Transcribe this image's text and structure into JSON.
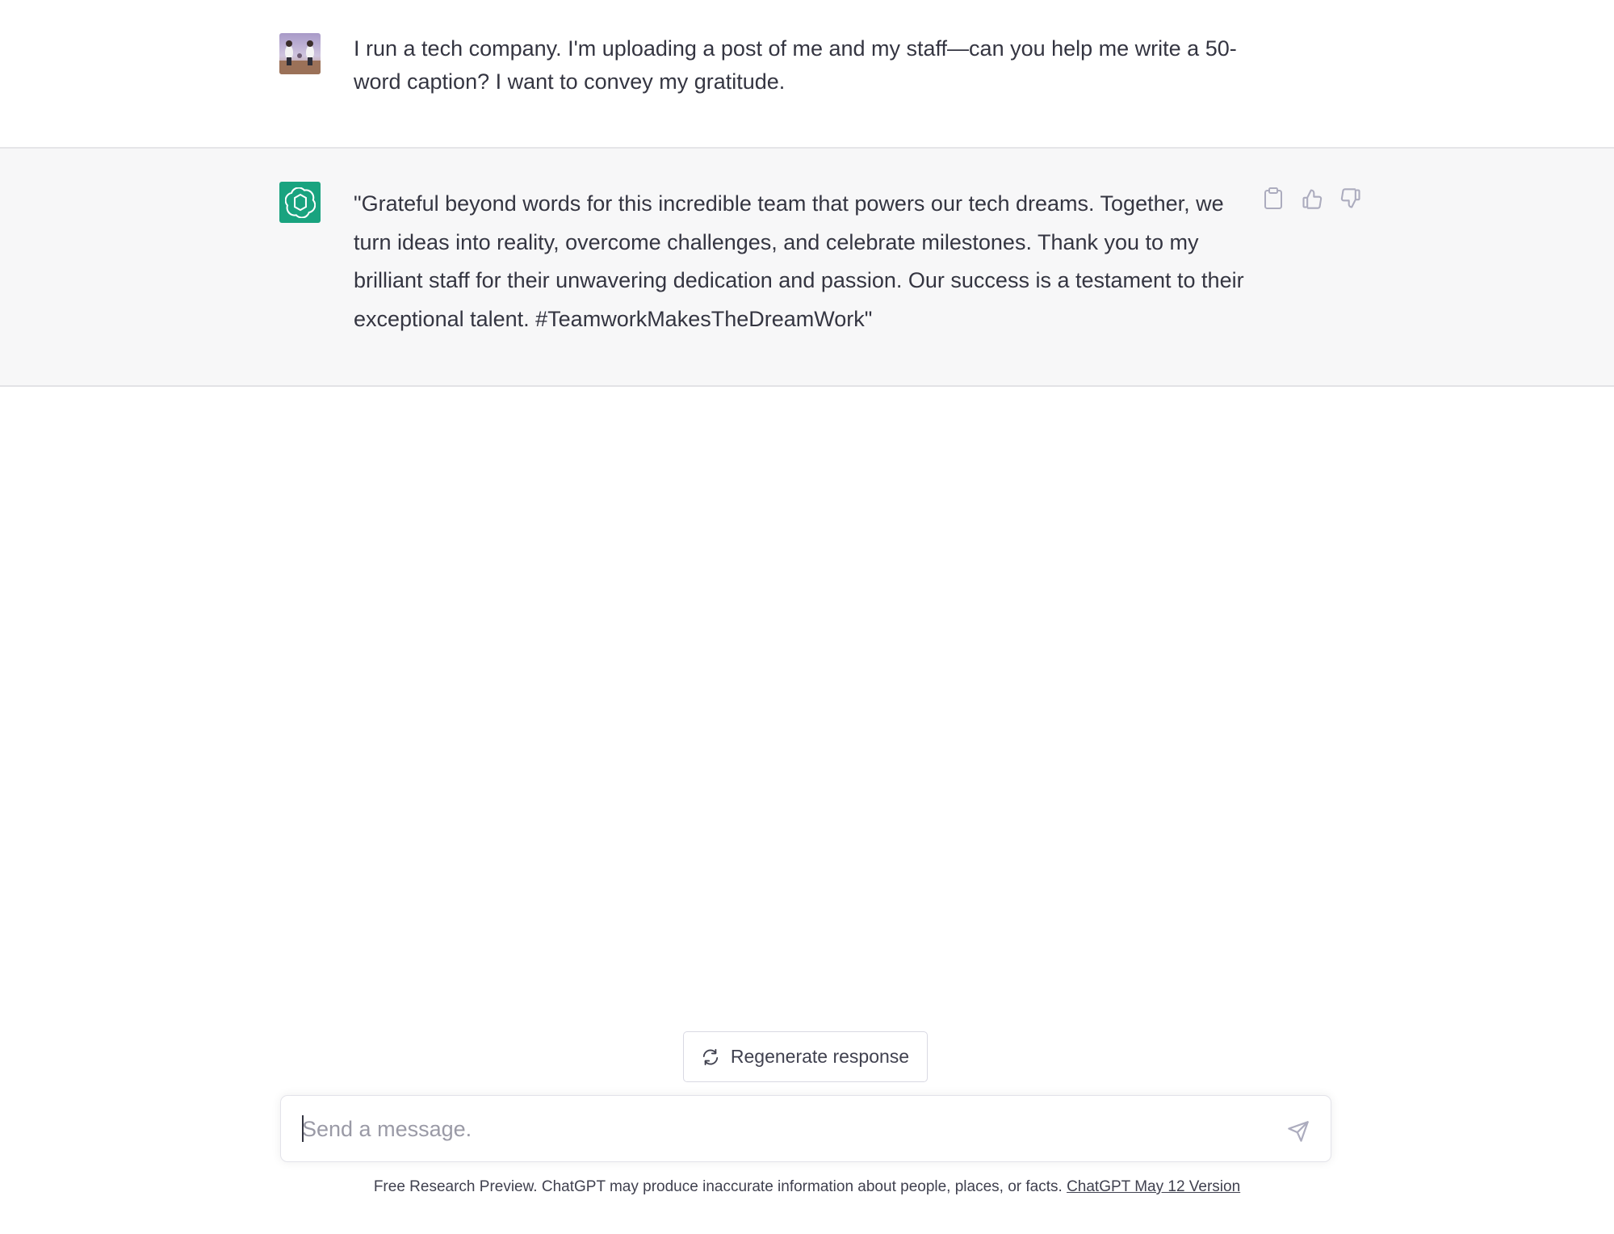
{
  "conversation": {
    "user_message": "I run a tech company.  I'm uploading a post of me and my staff—can you help me write a 50-word caption? I want to convey my gratitude.",
    "assistant_message": "\"Grateful beyond words for this incredible team that powers our tech dreams. Together, we turn ideas into reality, overcome challenges, and celebrate milestones. Thank you to my brilliant staff for their unwavering dedication and passion. Our success is a testament to their exceptional talent. #TeamworkMakesTheDreamWork\""
  },
  "actions": {
    "icons": [
      "clipboard-icon",
      "thumbs-up-icon",
      "thumbs-down-icon"
    ]
  },
  "regenerate": {
    "label": "Regenerate response",
    "icon": "refresh-icon"
  },
  "composer": {
    "placeholder": "Send a message.",
    "value": ""
  },
  "footer": {
    "text": "Free Research Preview. ChatGPT may produce inaccurate information about people, places, or facts. ",
    "link_text": "ChatGPT May 12 Version"
  },
  "colors": {
    "assistant_avatar": "#19a37f",
    "assistant_row_bg": "#f7f7f8",
    "text": "#343541"
  }
}
